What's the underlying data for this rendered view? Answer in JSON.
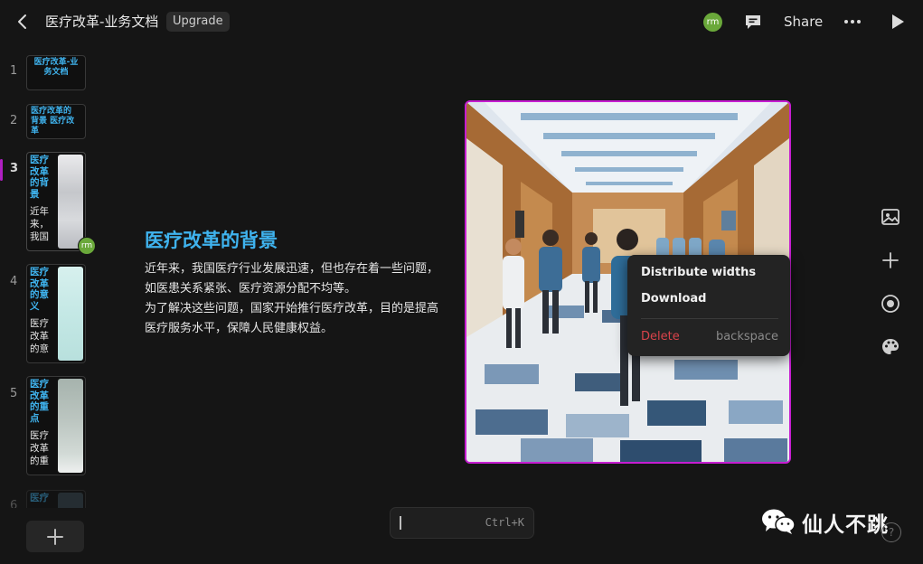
{
  "header": {
    "doc_title": "医疗改革-业务文档",
    "upgrade_label": "Upgrade",
    "avatar_initials": "rm",
    "share_label": "Share"
  },
  "slides": [
    {
      "num": "1",
      "title": "医疗改革-业务文档"
    },
    {
      "num": "2",
      "title": "医疗改革的背景 医疗改革"
    },
    {
      "num": "3",
      "title": "医疗改革的背景",
      "body": "近年来，我国"
    },
    {
      "num": "4",
      "title": "医疗改革的意义",
      "body": "医疗改革的意"
    },
    {
      "num": "5",
      "title": "医疗改革的重点",
      "body": "医疗改革的重"
    },
    {
      "num": "6",
      "title": "医疗"
    }
  ],
  "collaborator_initials": "rm",
  "slide": {
    "title": "医疗改革的背景",
    "paragraph1": "近年来，我国医疗行业发展迅速，但也存在着一些问题，如医患关系紧张、医疗资源分配不均等。",
    "paragraph2": "为了解决这些问题，国家开始推行医疗改革，目的是提高医疗服务水平，保障人民健康权益。"
  },
  "context_menu": {
    "item1": "Distribute widths",
    "item2": "Download",
    "delete": "Delete",
    "delete_shortcut": "backspace"
  },
  "command_bar": {
    "shortcut": "Ctrl+K"
  },
  "watermark": {
    "text": "仙人不跳"
  },
  "help": {
    "label": "?"
  },
  "colors": {
    "accent_title": "#3fb3ee",
    "selection": "#c61dd1",
    "danger": "#d9434a"
  },
  "icons": [
    "back-arrow-icon",
    "comment-icon",
    "more-icon",
    "play-icon",
    "image-icon",
    "plus-icon",
    "record-icon",
    "palette-icon",
    "wechat-icon",
    "help-icon"
  ]
}
